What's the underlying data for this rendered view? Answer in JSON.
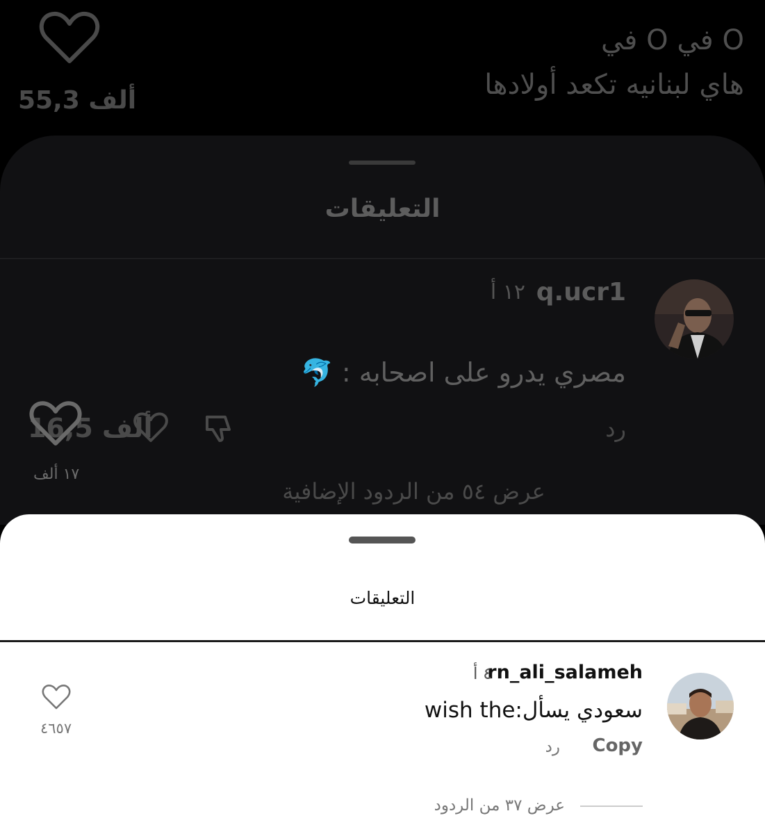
{
  "video": {
    "caption_line1": "في O في O",
    "caption_line2": "هاي لبنانيه تكعد أولادها",
    "like_count": "55,3 ألف"
  },
  "dark_sheet": {
    "title": "التعليقات",
    "comment": {
      "username": "q.ucr1",
      "time": "١٢ أ",
      "text": "مصري يدرو على اصحابه : 🐬",
      "reply_label": "رد",
      "like_count": "16,5 ألف"
    },
    "view_more": "عرض ٥٤ من الردود الإضافية"
  },
  "overlay": {
    "like_count": "١٧ ألف"
  },
  "white_sheet": {
    "title": "التعليقات",
    "comment": {
      "username": "rn_ali_salameh",
      "time": "٤ أ",
      "text": "سعودي يسأل:wish the",
      "copy_label": "Copy",
      "reply_label": "رد",
      "like_count": "٤٦٥٧"
    },
    "view_replies": "عرض ٣٧ من الردود"
  },
  "icons": {
    "heart": "heart-icon",
    "dislike": "thumb-down-icon",
    "avatar_dark": "avatar-man-sunglasses",
    "avatar_white": "avatar-man-smiling"
  }
}
